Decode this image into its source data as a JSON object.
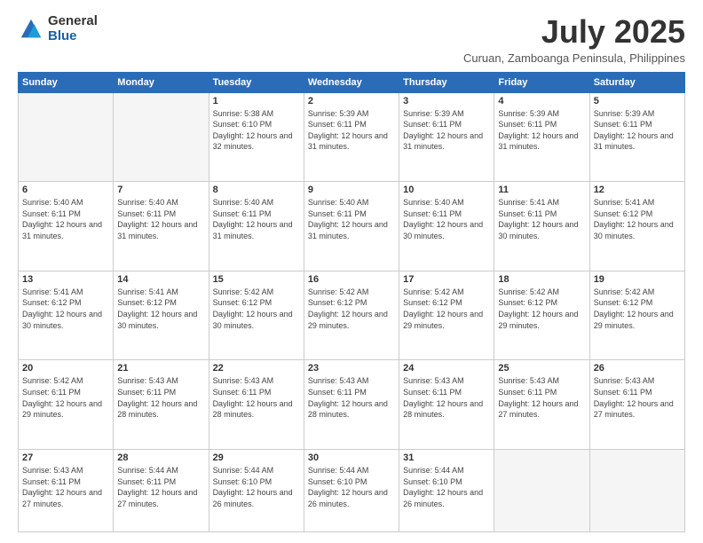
{
  "logo": {
    "general": "General",
    "blue": "Blue"
  },
  "title": "July 2025",
  "subtitle": "Curuan, Zamboanga Peninsula, Philippines",
  "days_of_week": [
    "Sunday",
    "Monday",
    "Tuesday",
    "Wednesday",
    "Thursday",
    "Friday",
    "Saturday"
  ],
  "weeks": [
    [
      {
        "day": "",
        "info": ""
      },
      {
        "day": "",
        "info": ""
      },
      {
        "day": "1",
        "info": "Sunrise: 5:38 AM\nSunset: 6:10 PM\nDaylight: 12 hours and 32 minutes."
      },
      {
        "day": "2",
        "info": "Sunrise: 5:39 AM\nSunset: 6:11 PM\nDaylight: 12 hours and 31 minutes."
      },
      {
        "day": "3",
        "info": "Sunrise: 5:39 AM\nSunset: 6:11 PM\nDaylight: 12 hours and 31 minutes."
      },
      {
        "day": "4",
        "info": "Sunrise: 5:39 AM\nSunset: 6:11 PM\nDaylight: 12 hours and 31 minutes."
      },
      {
        "day": "5",
        "info": "Sunrise: 5:39 AM\nSunset: 6:11 PM\nDaylight: 12 hours and 31 minutes."
      }
    ],
    [
      {
        "day": "6",
        "info": "Sunrise: 5:40 AM\nSunset: 6:11 PM\nDaylight: 12 hours and 31 minutes."
      },
      {
        "day": "7",
        "info": "Sunrise: 5:40 AM\nSunset: 6:11 PM\nDaylight: 12 hours and 31 minutes."
      },
      {
        "day": "8",
        "info": "Sunrise: 5:40 AM\nSunset: 6:11 PM\nDaylight: 12 hours and 31 minutes."
      },
      {
        "day": "9",
        "info": "Sunrise: 5:40 AM\nSunset: 6:11 PM\nDaylight: 12 hours and 31 minutes."
      },
      {
        "day": "10",
        "info": "Sunrise: 5:40 AM\nSunset: 6:11 PM\nDaylight: 12 hours and 30 minutes."
      },
      {
        "day": "11",
        "info": "Sunrise: 5:41 AM\nSunset: 6:11 PM\nDaylight: 12 hours and 30 minutes."
      },
      {
        "day": "12",
        "info": "Sunrise: 5:41 AM\nSunset: 6:12 PM\nDaylight: 12 hours and 30 minutes."
      }
    ],
    [
      {
        "day": "13",
        "info": "Sunrise: 5:41 AM\nSunset: 6:12 PM\nDaylight: 12 hours and 30 minutes."
      },
      {
        "day": "14",
        "info": "Sunrise: 5:41 AM\nSunset: 6:12 PM\nDaylight: 12 hours and 30 minutes."
      },
      {
        "day": "15",
        "info": "Sunrise: 5:42 AM\nSunset: 6:12 PM\nDaylight: 12 hours and 30 minutes."
      },
      {
        "day": "16",
        "info": "Sunrise: 5:42 AM\nSunset: 6:12 PM\nDaylight: 12 hours and 29 minutes."
      },
      {
        "day": "17",
        "info": "Sunrise: 5:42 AM\nSunset: 6:12 PM\nDaylight: 12 hours and 29 minutes."
      },
      {
        "day": "18",
        "info": "Sunrise: 5:42 AM\nSunset: 6:12 PM\nDaylight: 12 hours and 29 minutes."
      },
      {
        "day": "19",
        "info": "Sunrise: 5:42 AM\nSunset: 6:12 PM\nDaylight: 12 hours and 29 minutes."
      }
    ],
    [
      {
        "day": "20",
        "info": "Sunrise: 5:42 AM\nSunset: 6:11 PM\nDaylight: 12 hours and 29 minutes."
      },
      {
        "day": "21",
        "info": "Sunrise: 5:43 AM\nSunset: 6:11 PM\nDaylight: 12 hours and 28 minutes."
      },
      {
        "day": "22",
        "info": "Sunrise: 5:43 AM\nSunset: 6:11 PM\nDaylight: 12 hours and 28 minutes."
      },
      {
        "day": "23",
        "info": "Sunrise: 5:43 AM\nSunset: 6:11 PM\nDaylight: 12 hours and 28 minutes."
      },
      {
        "day": "24",
        "info": "Sunrise: 5:43 AM\nSunset: 6:11 PM\nDaylight: 12 hours and 28 minutes."
      },
      {
        "day": "25",
        "info": "Sunrise: 5:43 AM\nSunset: 6:11 PM\nDaylight: 12 hours and 27 minutes."
      },
      {
        "day": "26",
        "info": "Sunrise: 5:43 AM\nSunset: 6:11 PM\nDaylight: 12 hours and 27 minutes."
      }
    ],
    [
      {
        "day": "27",
        "info": "Sunrise: 5:43 AM\nSunset: 6:11 PM\nDaylight: 12 hours and 27 minutes."
      },
      {
        "day": "28",
        "info": "Sunrise: 5:44 AM\nSunset: 6:11 PM\nDaylight: 12 hours and 27 minutes."
      },
      {
        "day": "29",
        "info": "Sunrise: 5:44 AM\nSunset: 6:10 PM\nDaylight: 12 hours and 26 minutes."
      },
      {
        "day": "30",
        "info": "Sunrise: 5:44 AM\nSunset: 6:10 PM\nDaylight: 12 hours and 26 minutes."
      },
      {
        "day": "31",
        "info": "Sunrise: 5:44 AM\nSunset: 6:10 PM\nDaylight: 12 hours and 26 minutes."
      },
      {
        "day": "",
        "info": ""
      },
      {
        "day": "",
        "info": ""
      }
    ]
  ]
}
